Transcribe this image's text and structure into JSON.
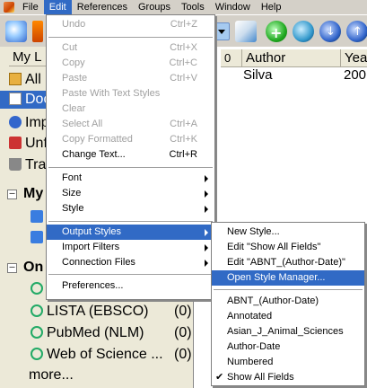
{
  "menubar": {
    "items": [
      "File",
      "Edit",
      "References",
      "Groups",
      "Tools",
      "Window",
      "Help"
    ]
  },
  "edit_menu": {
    "items": [
      {
        "label": "Undo",
        "shortcut": "Ctrl+Z"
      },
      {
        "label": "Cut",
        "shortcut": "Ctrl+X"
      },
      {
        "label": "Copy",
        "shortcut": "Ctrl+C"
      },
      {
        "label": "Paste",
        "shortcut": "Ctrl+V"
      },
      {
        "label": "Paste With Text Styles",
        "shortcut": ""
      },
      {
        "label": "Clear",
        "shortcut": ""
      },
      {
        "label": "Select All",
        "shortcut": "Ctrl+A"
      },
      {
        "label": "Copy Formatted",
        "shortcut": "Ctrl+K"
      },
      {
        "label": "Change Text...",
        "shortcut": "Ctrl+R"
      },
      {
        "label": "Font"
      },
      {
        "label": "Size"
      },
      {
        "label": "Style"
      },
      {
        "label": "Output Styles"
      },
      {
        "label": "Import Filters"
      },
      {
        "label": "Connection Files"
      },
      {
        "label": "Preferences..."
      }
    ]
  },
  "output_styles_menu": {
    "items": [
      {
        "label": "New Style..."
      },
      {
        "label": "Edit \"Show All Fields\""
      },
      {
        "label": "Edit \"ABNT_(Author-Date)\""
      },
      {
        "label": "Open Style Manager..."
      },
      {
        "label": "ABNT_(Author-Date)"
      },
      {
        "label": "Annotated"
      },
      {
        "label": "Asian_J_Animal_Sciences"
      },
      {
        "label": "Author-Date"
      },
      {
        "label": "Numbered"
      },
      {
        "label": "Show All Fields"
      }
    ]
  },
  "library": {
    "col_headers": [
      "My L",
      "Author",
      "Yea"
    ],
    "paperclip": "0",
    "author": "Silva",
    "year": "200",
    "left_items": [
      "All I",
      "Doc",
      "Imp",
      "Unf",
      "Tra"
    ],
    "my_groups": "My",
    "online": "On",
    "online_items": [
      {
        "label": "LISTA (EBSCO)",
        "count": "(0)"
      },
      {
        "label": "PubMed (NLM)",
        "count": "(0)"
      },
      {
        "label": "Web of Science ...",
        "count": "(0)"
      }
    ],
    "more": "more..."
  }
}
